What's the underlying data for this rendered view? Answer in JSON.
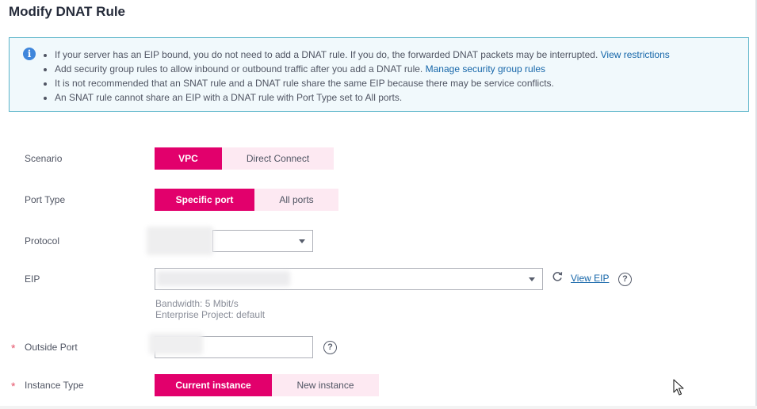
{
  "page": {
    "title": "Modify DNAT Rule"
  },
  "notice": {
    "items": [
      {
        "text": "If your server has an EIP bound, you do not need to add a DNAT rule. If you do, the forwarded DNAT packets may be interrupted.",
        "link": "View restrictions"
      },
      {
        "text": "Add security group rules to allow inbound or outbound traffic after you add a DNAT rule.",
        "link": "Manage security group rules"
      },
      {
        "text": "It is not recommended that an SNAT rule and a DNAT rule share the same EIP because there may be service conflicts.",
        "link": ""
      },
      {
        "text": "An SNAT rule cannot share an EIP with a DNAT rule with Port Type set to All ports.",
        "link": ""
      }
    ]
  },
  "form": {
    "scenario": {
      "label": "Scenario",
      "options": [
        "VPC",
        "Direct Connect"
      ],
      "selected": "VPC"
    },
    "port_type": {
      "label": "Port Type",
      "options": [
        "Specific port",
        "All ports"
      ],
      "selected": "Specific port"
    },
    "protocol": {
      "label": "Protocol",
      "value": ""
    },
    "eip": {
      "label": "EIP",
      "value": "",
      "view_link": "View EIP",
      "bandwidth": "Bandwidth: 5 Mbit/s",
      "enterprise_project": "Enterprise Project: default"
    },
    "outside_port": {
      "label": "Outside Port",
      "required_mark": "*",
      "value": ""
    },
    "instance_type": {
      "label": "Instance Type",
      "required_mark": "*",
      "options": [
        "Current instance",
        "New instance"
      ],
      "selected": "Current instance"
    }
  },
  "icons": {
    "info": "info-icon",
    "refresh": "refresh-icon",
    "help": "question-circle-icon",
    "cursor": "mouse-pointer-icon"
  },
  "colors": {
    "accent": "#e2006c",
    "accent_light": "#fde9f2",
    "link": "#1566a9",
    "notice_border": "#5ab4c9",
    "notice_bg": "#f1f9fc",
    "required": "#e5546a"
  }
}
